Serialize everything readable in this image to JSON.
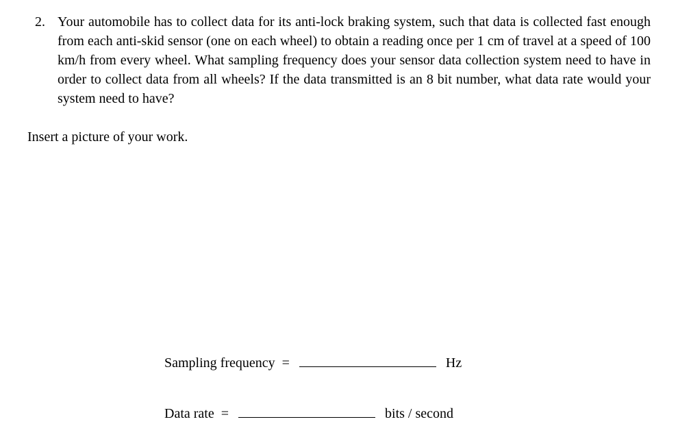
{
  "question": {
    "number": "2.",
    "text": "Your automobile has to collect data for its anti-lock braking system, such that data is collected fast enough from each anti-skid sensor (one on each wheel) to obtain a reading once per 1 cm of travel at a speed of 100 km/h from every wheel.  What sampling frequency does your sensor data collection system need to have in order to collect data from all wheels? If the data transmitted is an 8 bit number, what data rate would your system need to have?"
  },
  "instruction": "Insert a picture of your work.",
  "answers": {
    "line1": {
      "label": "Sampling frequency  =  ",
      "value": "",
      "unit": "  Hz"
    },
    "line2": {
      "label": "Data rate  =  ",
      "value": "",
      "unit": "  bits / second"
    }
  }
}
